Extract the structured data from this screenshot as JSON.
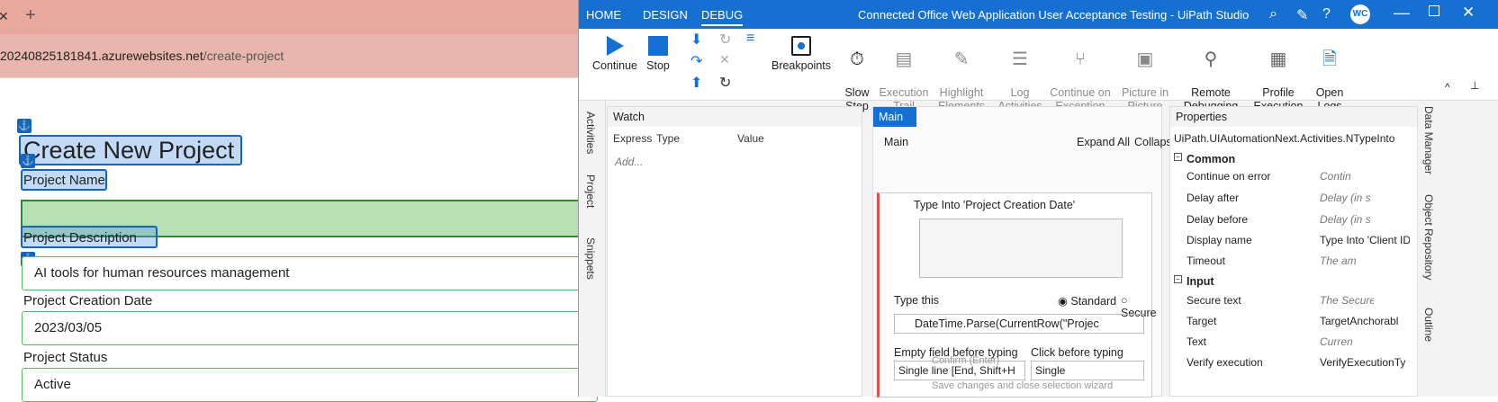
{
  "browser": {
    "tab_close": "✕",
    "tab_add": "+",
    "url_host": "20240825181841.azurewebsites.net",
    "url_path": "/create-project"
  },
  "webpage": {
    "title": "Create New Project",
    "fields": [
      {
        "label": "Project Name",
        "value": ""
      },
      {
        "label": "Project Description",
        "value": "AI tools for human resources management"
      },
      {
        "label": "Project Creation Date",
        "value": "2023/03/05"
      },
      {
        "label": "Project Status",
        "value": "Active"
      }
    ]
  },
  "studio": {
    "menu": [
      "HOME",
      "DESIGN",
      "DEBUG"
    ],
    "title": "Connected Office Web Application  User Acceptance Testing - UiPath Studio",
    "avatar": "WC",
    "ribbon": {
      "continue": "Continue",
      "stop": "Stop",
      "breakpoints": "Breakpoints",
      "slow_step": "Slow\nStep",
      "execution_trail": "Execution\nTrail",
      "highlight_elements": "Highlight\nElements",
      "log_activities": "Log\nActivities",
      "continue_on_exception": "Continue on\nException",
      "picture_in_picture": "Picture in\nPicture",
      "remote_debugging": "Remote\nDebugging",
      "profile_execution": "Profile\nExecution",
      "open_logs": "Open\nLogs"
    },
    "side_tabs": [
      "Activities",
      "Project",
      "Snippets"
    ],
    "right_tabs": [
      "Data Manager",
      "Object Repository",
      "Outline"
    ],
    "watch": {
      "title": "Watch",
      "columns": [
        "Express",
        "Type",
        "Value"
      ],
      "add_placeholder": "Add..."
    },
    "main": {
      "tab": "Main",
      "breadcrumb": "Main",
      "expand_all": "Expand All",
      "collapse_all": "Collapse All",
      "activity_title": "Type Into 'Project Creation Date'",
      "type_this_label": "Type this",
      "radio_standard": "Standard",
      "radio_secure": "Secure",
      "expression": "DateTime.Parse(CurrentRow(\"Projec",
      "empty_field_label": "Empty field before typing",
      "empty_field_value": "Single line [End, Shift+H",
      "click_before_label": "Click before typing",
      "click_before_value": "Single",
      "ghost_confirm": "Confirm (Enter)",
      "ghost_save": "Save changes and close selection wizard"
    },
    "properties": {
      "title": "Properties",
      "type_name": "UiPath.UIAutomationNext.Activities.NTypeInto",
      "sections": [
        {
          "name": "Common",
          "rows": [
            {
              "name": "Continue on error",
              "value": "Contin"
            },
            {
              "name": "Delay after",
              "value": "Delay (in s"
            },
            {
              "name": "Delay before",
              "value": "Delay (in s"
            },
            {
              "name": "Display name",
              "value": "Type Into 'Client ID'"
            },
            {
              "name": "Timeout",
              "value": "The am"
            }
          ]
        },
        {
          "name": "Input",
          "rows": [
            {
              "name": "Secure text",
              "value": "The Secure"
            },
            {
              "name": "Target",
              "value": "TargetAnchorabl"
            },
            {
              "name": "Text",
              "value": "Curren"
            },
            {
              "name": "Verify execution",
              "value": "VerifyExecutionTy"
            }
          ]
        }
      ]
    }
  }
}
